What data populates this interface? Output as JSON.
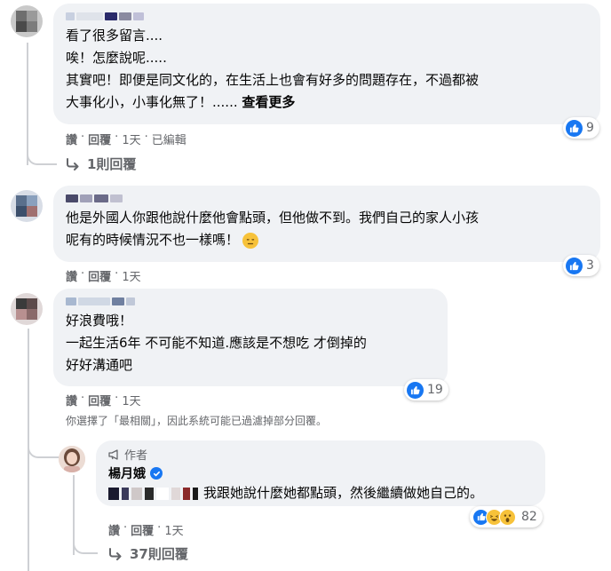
{
  "comments": [
    {
      "lines": [
        "看了很多留言....",
        "唉！怎麼說呢.....",
        "其實吧！即便是同文化的，在生活上也會有好多的問題存在，不過都被",
        "大事化小，小事化無了！......"
      ],
      "see_more": "查看更多",
      "reaction_count": "9",
      "actions": {
        "like": "讚",
        "reply": "回覆",
        "time": "1天",
        "edited": "已編輯"
      },
      "replies_link": "1則回覆"
    },
    {
      "lines": [
        "他是外國人你跟他說什麼他會點頭，但他做不到。我們自己的家人小孩",
        "呢有的時候情況不也一樣嗎！"
      ],
      "reaction_count": "3",
      "actions": {
        "like": "讚",
        "reply": "回覆",
        "time": "1天"
      }
    },
    {
      "lines": [
        "好浪費哦！",
        "一起生活6年 不可能不知道.應該是不想吃 才倒掉的",
        "好好溝通吧"
      ],
      "reaction_count": "19",
      "actions": {
        "like": "讚",
        "reply": "回覆",
        "time": "1天"
      }
    }
  ],
  "filter_notice": "你選擇了「最相關」，因此系統可能已過濾掉部分回覆。",
  "author_reply": {
    "tag": "作者",
    "name": "楊月娥",
    "text": "我跟她說什麼她都點頭，然後繼續做她自己的。",
    "reaction_count": "82",
    "actions": {
      "like": "讚",
      "reply": "回覆",
      "time": "1天"
    },
    "replies_link": "37則回覆"
  },
  "colors": {
    "like_blue": "#1877f2",
    "bubble": "#f0f2f5",
    "muted": "#65676b"
  }
}
